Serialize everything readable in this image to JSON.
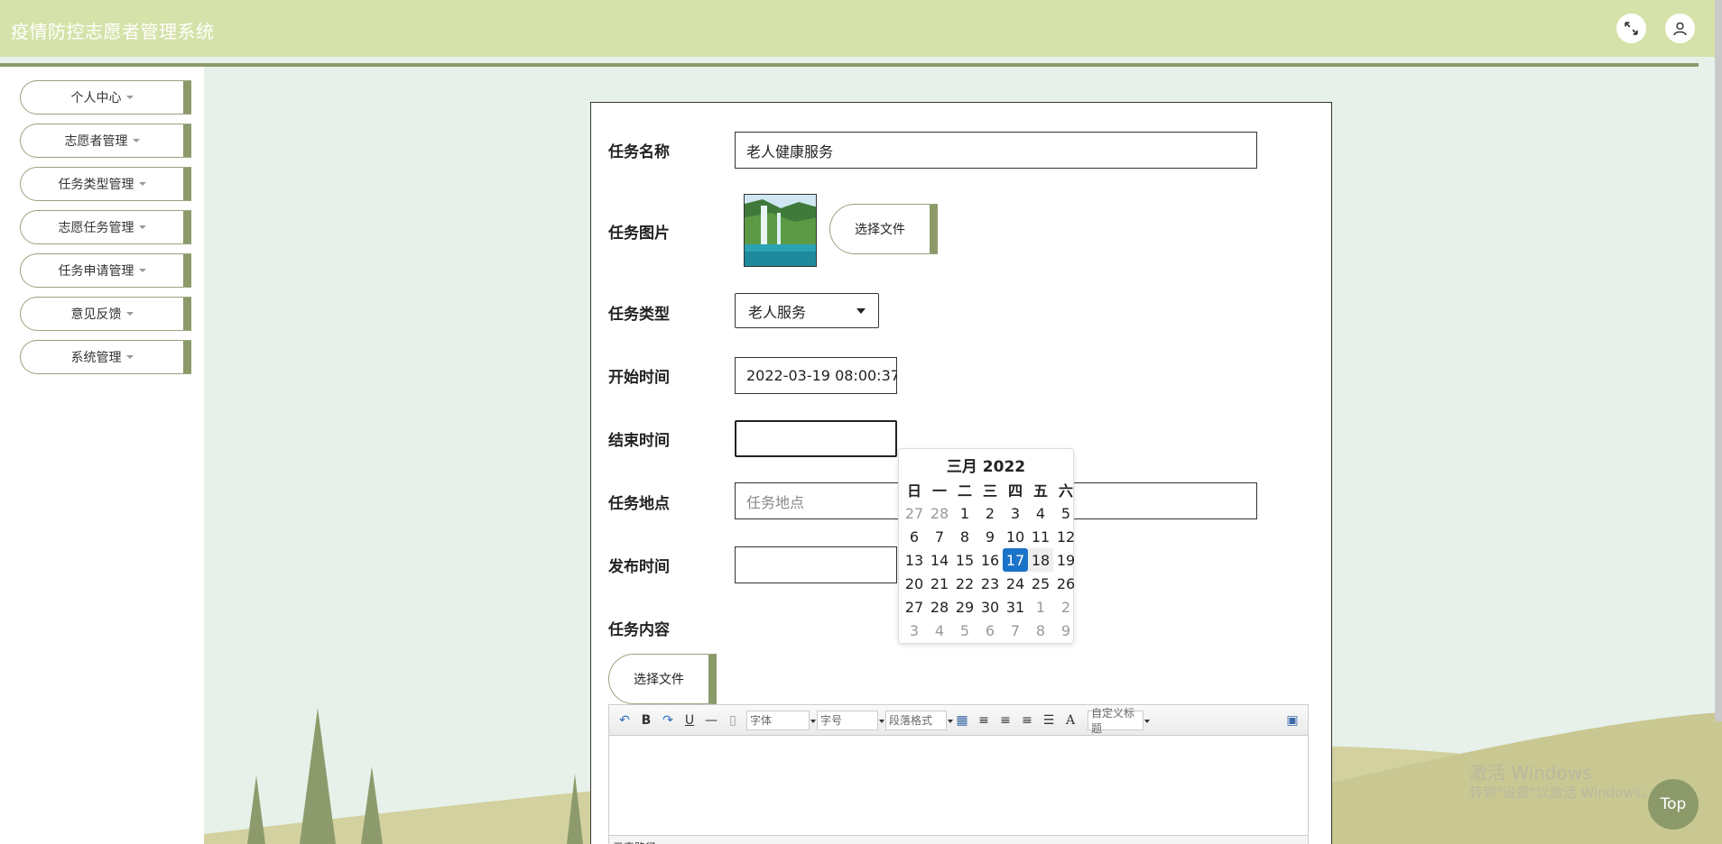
{
  "header": {
    "title": "疫情防控志愿者管理系统",
    "fullscreen_icon": "expand-icon",
    "user_icon": "user-icon"
  },
  "sidebar": {
    "items": [
      {
        "label": "个人中心"
      },
      {
        "label": "志愿者管理"
      },
      {
        "label": "任务类型管理"
      },
      {
        "label": "志愿任务管理"
      },
      {
        "label": "任务申请管理"
      },
      {
        "label": "意见反馈"
      },
      {
        "label": "系统管理"
      }
    ]
  },
  "form": {
    "task_name": {
      "label": "任务名称",
      "value": "老人健康服务"
    },
    "task_image": {
      "label": "任务图片",
      "button": "选择文件"
    },
    "task_type": {
      "label": "任务类型",
      "value": "老人服务"
    },
    "start_time": {
      "label": "开始时间",
      "value": "2022-03-19 08:00:37"
    },
    "end_time": {
      "label": "结束时间",
      "value": ""
    },
    "location": {
      "label": "任务地点",
      "placeholder": "任务地点"
    },
    "publish_time": {
      "label": "发布时间",
      "value": ""
    },
    "content": {
      "label": "任务内容",
      "button": "选择文件"
    }
  },
  "editor": {
    "font_combo": "字体",
    "size_combo": "字号",
    "paragraph_combo": "段落格式",
    "custom_title_combo": "自定义标题",
    "path_label": "元素路径:"
  },
  "datepicker": {
    "title": "三月 2022",
    "weekdays": [
      "日",
      "一",
      "二",
      "三",
      "四",
      "五",
      "六"
    ],
    "weeks": [
      [
        {
          "d": "27",
          "m": true
        },
        {
          "d": "28",
          "m": true
        },
        {
          "d": "1"
        },
        {
          "d": "2"
        },
        {
          "d": "3"
        },
        {
          "d": "4"
        },
        {
          "d": "5"
        }
      ],
      [
        {
          "d": "6"
        },
        {
          "d": "7"
        },
        {
          "d": "8"
        },
        {
          "d": "9"
        },
        {
          "d": "10"
        },
        {
          "d": "11"
        },
        {
          "d": "12"
        }
      ],
      [
        {
          "d": "13"
        },
        {
          "d": "14"
        },
        {
          "d": "15"
        },
        {
          "d": "16"
        },
        {
          "d": "17",
          "today": true
        },
        {
          "d": "18",
          "hover": true
        },
        {
          "d": "19"
        }
      ],
      [
        {
          "d": "20"
        },
        {
          "d": "21"
        },
        {
          "d": "22"
        },
        {
          "d": "23"
        },
        {
          "d": "24"
        },
        {
          "d": "25"
        },
        {
          "d": "26"
        }
      ],
      [
        {
          "d": "27"
        },
        {
          "d": "28"
        },
        {
          "d": "29"
        },
        {
          "d": "30"
        },
        {
          "d": "31"
        },
        {
          "d": "1",
          "m": true
        },
        {
          "d": "2",
          "m": true
        }
      ],
      [
        {
          "d": "3",
          "m": true
        },
        {
          "d": "4",
          "m": true
        },
        {
          "d": "5",
          "m": true
        },
        {
          "d": "6",
          "m": true
        },
        {
          "d": "7",
          "m": true
        },
        {
          "d": "8",
          "m": true
        },
        {
          "d": "9",
          "m": true
        }
      ]
    ]
  },
  "watermark": {
    "line1": "激活 Windows",
    "line2": "转到\"设置\"以激活 Windows。"
  },
  "top_button": "Top",
  "colors": {
    "header_bg": "#d5e2a9",
    "accent": "#8c9a6a",
    "today": "#1a73c9"
  }
}
